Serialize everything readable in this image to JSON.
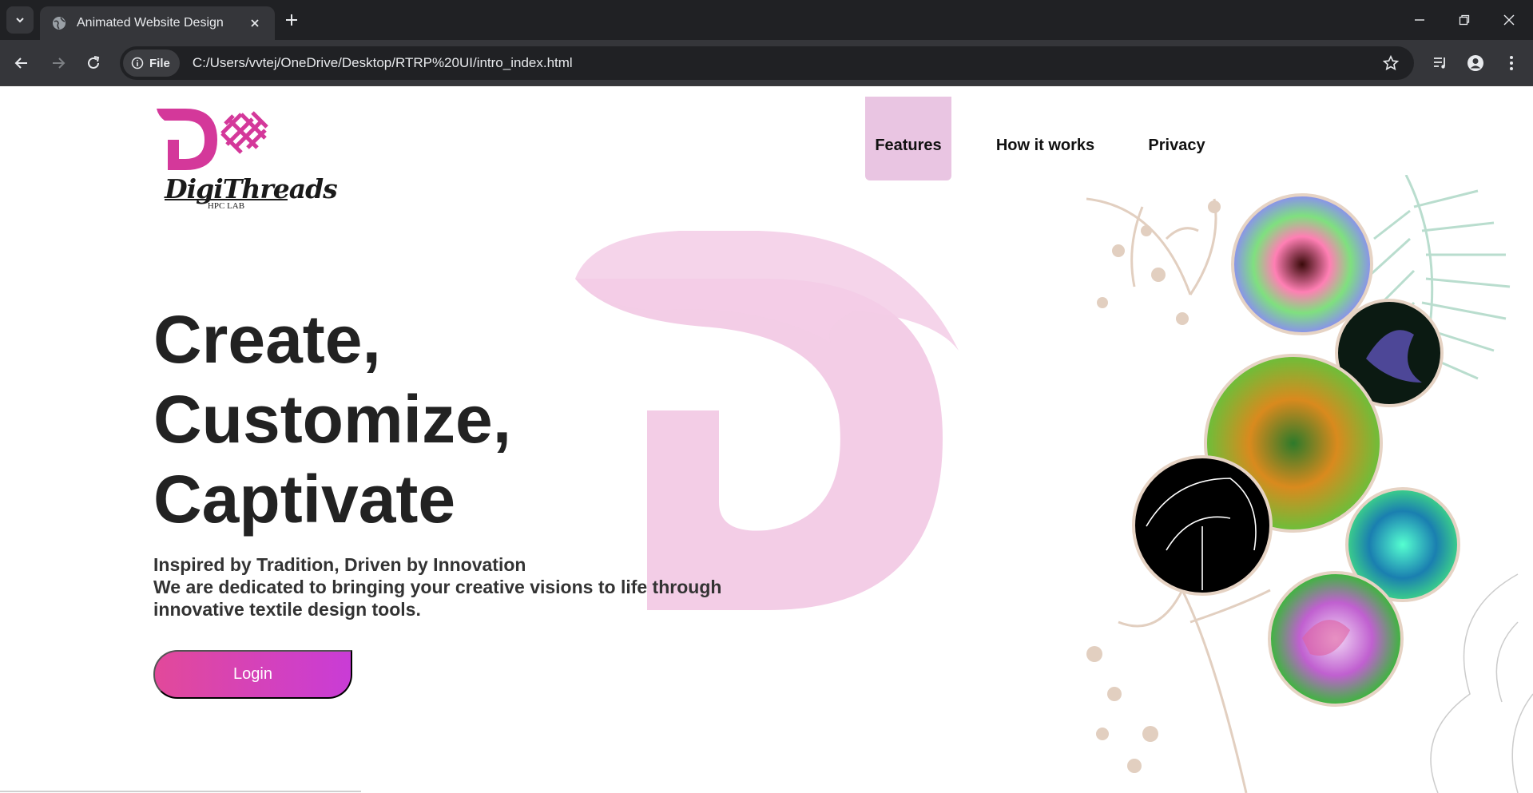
{
  "browser": {
    "tab_title": "Animated Website Design",
    "file_chip_label": "File",
    "url": "C:/Users/vvtej/OneDrive/Desktop/RTRP%20UI/intro_index.html",
    "icons": [
      "tab-search-icon",
      "globe-icon",
      "close-icon",
      "plus-icon",
      "minimize-icon",
      "restore-icon",
      "window-close-icon",
      "back-arrow-icon",
      "forward-arrow-icon",
      "reload-icon",
      "info-icon",
      "star-icon",
      "media-icon",
      "profile-icon",
      "kebab-menu-icon"
    ]
  },
  "site": {
    "logo": {
      "wordmark": "DigiThreads",
      "subtitle": "HPC LAB",
      "color": "#d4389a"
    },
    "nav": [
      {
        "label": "Features",
        "active": true
      },
      {
        "label": "How it works",
        "active": false
      },
      {
        "label": "Privacy",
        "active": false
      }
    ],
    "headline": [
      "Create,",
      "Customize,",
      "Captivate"
    ],
    "tagline": {
      "line1": "Inspired by Tradition, Driven by Innovation",
      "line2": "We are dedicated to bringing your creative visions to life through innovative textile design tools."
    },
    "login_label": "Login",
    "colors": {
      "accent_start": "#e2499a",
      "accent_end": "#c93cd6",
      "nav_active_bg": "#e9c5e2",
      "watermark": "#f3cde6"
    }
  }
}
